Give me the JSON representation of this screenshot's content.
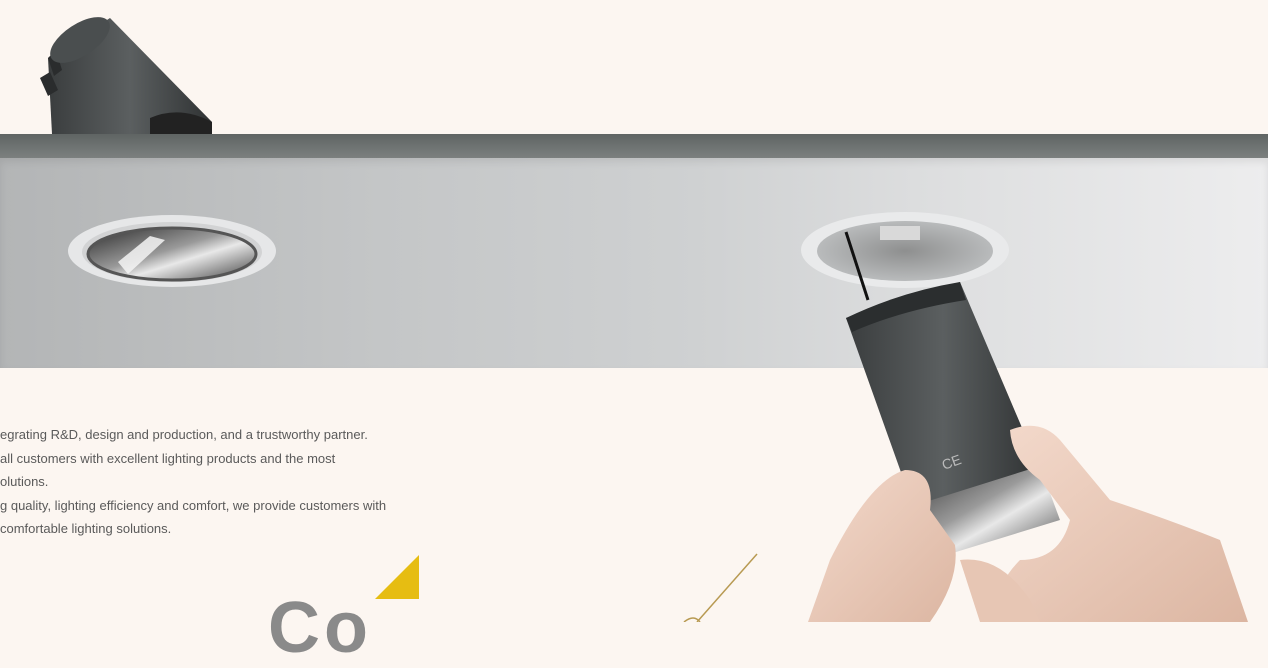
{
  "intro": {
    "lines": [
      "egrating R&D, design and production, and a trustworthy partner.",
      " all customers with excellent lighting products and the most",
      "olutions.",
      "g quality, lighting efficiency and comfort, we provide customers with",
      " comfortable lighting solutions."
    ]
  },
  "heading_fragment": "Co",
  "colors": {
    "accent": "#e6bd12",
    "background": "#fcf6f1",
    "line": "#b89a52"
  },
  "images": {
    "hero": "recessed-downlight-ceiling-installation-photo"
  }
}
